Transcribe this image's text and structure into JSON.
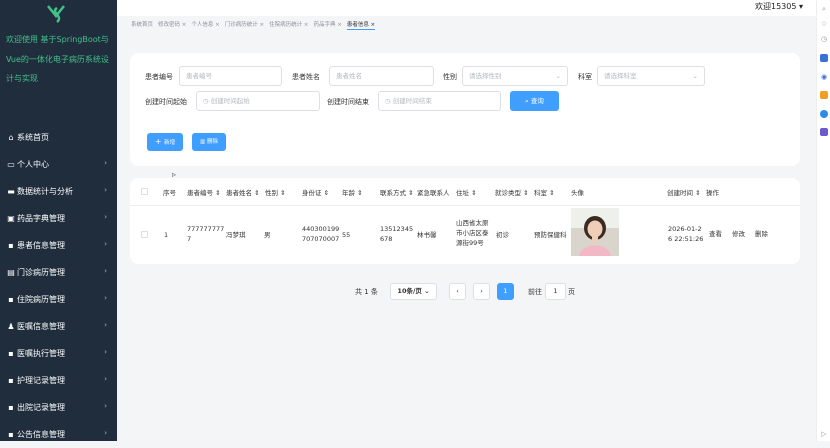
{
  "app": {
    "title": "欢迎使用 基于SpringBoot与Vue的一体化电子病历系统设计与实现",
    "user": "欢迎15305"
  },
  "sidebar": {
    "items": [
      {
        "label": "系统首页",
        "icon": "home-icon"
      },
      {
        "label": "个人中心",
        "icon": "user-card-icon"
      },
      {
        "label": "数据统计与分析",
        "icon": "folder-icon"
      },
      {
        "label": "药品字典管理",
        "icon": "clipboard-icon"
      },
      {
        "label": "患者信息管理",
        "icon": "grid-icon"
      },
      {
        "label": "门诊病历管理",
        "icon": "document-icon"
      },
      {
        "label": "住院病历管理",
        "icon": "grid-icon"
      },
      {
        "label": "医嘱信息管理",
        "icon": "person-icon"
      },
      {
        "label": "医嘱执行管理",
        "icon": "grid-icon"
      },
      {
        "label": "护理记录管理",
        "icon": "grid-icon"
      },
      {
        "label": "出院记录管理",
        "icon": "grid-icon"
      },
      {
        "label": "公告信息管理",
        "icon": "grid-icon"
      }
    ]
  },
  "tabs": [
    {
      "label": "系统首页"
    },
    {
      "label": "修改密码 ×"
    },
    {
      "label": "个人信息 ×"
    },
    {
      "label": "门诊病历统计 ×"
    },
    {
      "label": "住院病历统计 ×"
    },
    {
      "label": "药品字典 ×"
    },
    {
      "label": "患者信息 ×"
    }
  ],
  "filters": {
    "patient_no_label": "患者编号",
    "patient_no_placeholder": "患者编号",
    "patient_name_label": "患者姓名",
    "patient_name_placeholder": "患者姓名",
    "gender_label": "性别",
    "gender_placeholder": "请选择性别",
    "dept_label": "科室",
    "dept_placeholder": "请选择科室",
    "start_label": "创建时间起始",
    "start_placeholder": "创建时间起始",
    "end_label": "创建时间结束",
    "end_placeholder": "创建时间结束",
    "search_label": "查询"
  },
  "actions": {
    "add_label": "新增",
    "delete_label": "删除"
  },
  "table": {
    "headers": [
      "序号",
      "患者编号",
      "患者姓名",
      "性别",
      "身份证",
      "年龄",
      "联系方式",
      "紧急联系人",
      "住址",
      "就诊类型",
      "科室",
      "头像",
      "创建时间",
      "操作"
    ],
    "rows": [
      {
        "index": "1",
        "patient_no": "7777777777",
        "name": "冯梦琪",
        "gender": "男",
        "id_card": "440300199707070007",
        "age": "55",
        "phone": "13512345678",
        "emergency_contact": "林书馨",
        "address": "山西省太原市小店区泰源街99号",
        "visit_type": "初诊",
        "department": "预防保健科",
        "created_at": "2026-01-26 22:51:26",
        "ops": [
          "查看",
          "修改",
          "删除"
        ]
      }
    ]
  },
  "pagination": {
    "total": "共 1 条",
    "page_size": "10条/页",
    "current": "1",
    "goto_prefix": "前往",
    "goto_value": "1",
    "goto_suffix": "页"
  }
}
